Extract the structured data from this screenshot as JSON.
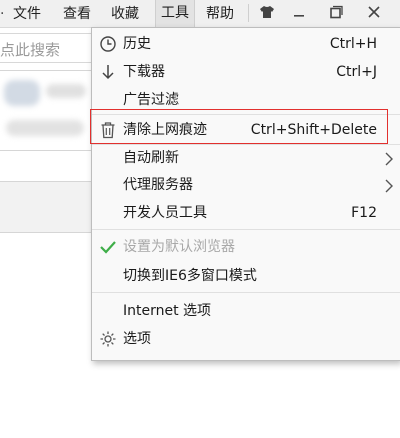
{
  "menubar": {
    "items": [
      {
        "label": "文件"
      },
      {
        "label": "查看"
      },
      {
        "label": "收藏"
      },
      {
        "label": "工具",
        "active": true
      },
      {
        "label": "帮助"
      }
    ],
    "window_controls": {
      "skin": "tshirt-icon",
      "minimize": "minimize-icon",
      "maximize": "maximize-icon",
      "close": "close-icon"
    }
  },
  "search": {
    "placeholder": "点此搜索"
  },
  "tools_menu": {
    "items": [
      {
        "icon": "clock-icon",
        "label": "历史",
        "shortcut": "Ctrl+H"
      },
      {
        "icon": "download-arrow-icon",
        "label": "下载器",
        "shortcut": "Ctrl+J"
      },
      {
        "icon": "",
        "label": "广告过滤",
        "shortcut": ""
      },
      {
        "icon": "trash-icon",
        "label": "清除上网痕迹",
        "shortcut": "Ctrl+Shift+Delete",
        "highlighted": true
      },
      {
        "icon": "",
        "label": "自动刷新",
        "shortcut": "",
        "submenu": true
      },
      {
        "icon": "",
        "label": "代理服务器",
        "shortcut": "",
        "submenu": true
      },
      {
        "icon": "",
        "label": "开发人员工具",
        "shortcut": "F12"
      },
      {
        "icon": "checkmark-icon",
        "label": "设置为默认浏览器",
        "shortcut": "",
        "disabled": true
      },
      {
        "icon": "",
        "label": "切换到IE6多窗口模式",
        "shortcut": ""
      },
      {
        "icon": "",
        "label": "Internet 选项",
        "shortcut": ""
      },
      {
        "icon": "gear-icon",
        "label": "选项",
        "shortcut": ""
      }
    ]
  },
  "colors": {
    "highlight_border": "#e2302e",
    "checkmark": "#3fae49",
    "disabled_text": "#a8a8a8"
  }
}
